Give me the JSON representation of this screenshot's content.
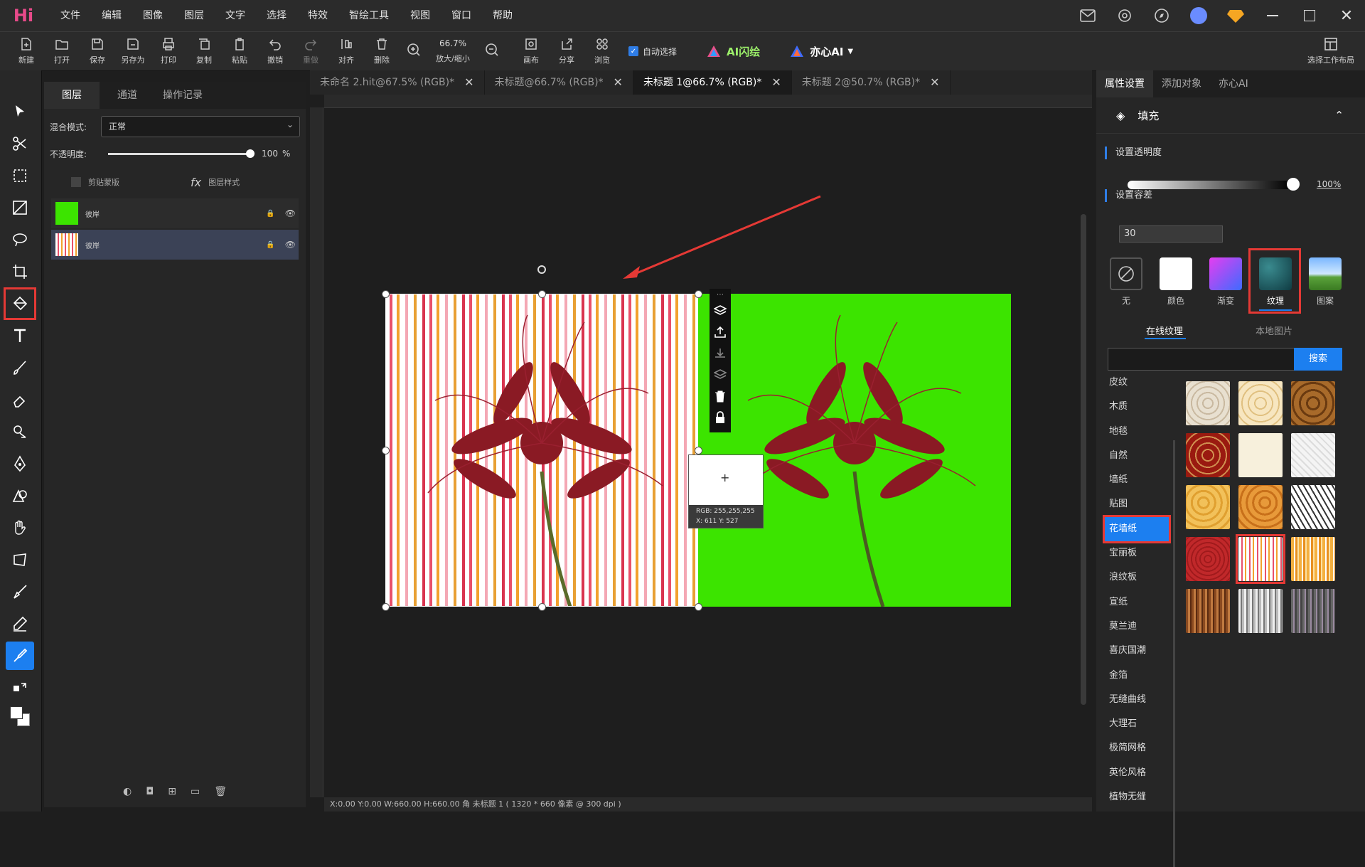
{
  "app": {
    "logo_text": "Hi"
  },
  "menu": [
    "文件",
    "编辑",
    "图像",
    "图层",
    "文字",
    "选择",
    "特效",
    "智绘工具",
    "视图",
    "窗口",
    "帮助"
  ],
  "toolbar": {
    "buttons": [
      {
        "name": "new",
        "label": "新建"
      },
      {
        "name": "open",
        "label": "打开"
      },
      {
        "name": "save",
        "label": "保存"
      },
      {
        "name": "save-as",
        "label": "另存为"
      },
      {
        "name": "print",
        "label": "打印"
      },
      {
        "name": "copy",
        "label": "复制"
      },
      {
        "name": "paste",
        "label": "粘贴"
      },
      {
        "name": "undo",
        "label": "撤销"
      },
      {
        "name": "redo",
        "label": "重做"
      },
      {
        "name": "align",
        "label": "对齐"
      },
      {
        "name": "delete",
        "label": "删除"
      }
    ],
    "zoom_value": "66.7%",
    "zoom_label": "放大/缩小",
    "buttons2": [
      {
        "name": "canvas",
        "label": "画布"
      },
      {
        "name": "share",
        "label": "分享"
      },
      {
        "name": "browse",
        "label": "浏览"
      }
    ],
    "auto_select": "自动选择",
    "ai_flash": "AI闪绘",
    "yixin_ai": "亦心AI",
    "workspace": "选择工作布局"
  },
  "layers_panel": {
    "tabs": [
      "图层",
      "通道",
      "操作记录"
    ],
    "blend_label": "混合模式:",
    "blend_value": "正常",
    "opacity_label": "不透明度:",
    "opacity_value": "100",
    "opacity_unit": "%",
    "clip_mask": "剪贴蒙版",
    "layer_style": "图层样式",
    "layers": [
      {
        "name": "彼岸"
      },
      {
        "name": "彼岸"
      }
    ]
  },
  "documents": {
    "tabs": [
      {
        "label": "未命名 2.hit@67.5% (RGB)*",
        "active": false
      },
      {
        "label": "未标题@66.7% (RGB)*",
        "active": false
      },
      {
        "label": "未标题 1@66.7% (RGB)*",
        "active": true
      },
      {
        "label": "未标题 2@50.7% (RGB)*",
        "active": false
      }
    ],
    "status": "X:0.00  Y:0.00  W:660.00  H:660.00  角    未标题 1 ( 1320 * 660 像素 @ 300 dpi )",
    "cursor_rgb": "RGB:  255,255,255",
    "cursor_xy": "X: 611   Y: 527"
  },
  "right_panel": {
    "tabs": [
      "属性设置",
      "添加对象",
      "亦心AI"
    ],
    "fill_title": "填充",
    "transparency_label": "设置透明度",
    "transparency_value": "100%",
    "tolerance_label": "设置容差",
    "tolerance_value": "30",
    "fill_options": [
      {
        "name": "none",
        "label": "无"
      },
      {
        "name": "color",
        "label": "颜色"
      },
      {
        "name": "gradient",
        "label": "渐变"
      },
      {
        "name": "texture",
        "label": "纹理"
      },
      {
        "name": "pattern",
        "label": "图案"
      }
    ],
    "texture_tabs": [
      "在线纹理",
      "本地图片"
    ],
    "search_button": "搜索",
    "categories": [
      "皮纹",
      "木质",
      "地毯",
      "自然",
      "墙纸",
      "贴图",
      "花墙纸",
      "宝丽板",
      "浪纹板",
      "宣纸",
      "莫兰迪",
      "喜庆国潮",
      "金箔",
      "无缝曲线",
      "大理石",
      "极简网格",
      "英伦风格",
      "植物无缝"
    ],
    "active_category": "花墙纸"
  },
  "colors": {
    "accent": "#1c7ff0",
    "highlight": "#e53935",
    "green_bg": "#3ce400"
  }
}
